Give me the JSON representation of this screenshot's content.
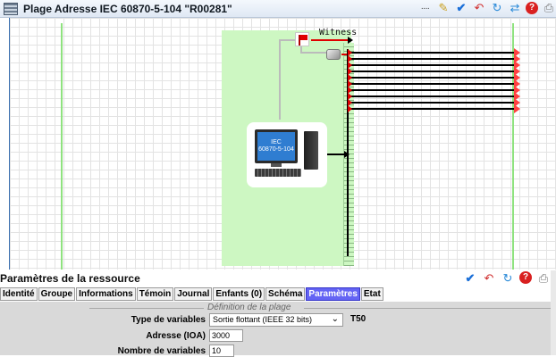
{
  "window": {
    "title": "Plage Adresse IEC 60870-5-104 \"R00281\"",
    "more_glyph": "····",
    "toolbar_icons": [
      "edit-icon",
      "check-icon",
      "undo-icon",
      "refresh-icon",
      "sync-icon",
      "help-icon",
      "print-icon"
    ]
  },
  "diagram": {
    "witness_label": "Witness",
    "device_screen_text": "IEC\n60870-5-104",
    "output_lines": 10
  },
  "panel": {
    "title": "Paramètres de la ressource",
    "icons": [
      "check-icon",
      "undo-icon",
      "refresh-icon",
      "help-icon",
      "print-icon"
    ],
    "tabs": [
      "Identité",
      "Groupe",
      "Informations",
      "Témoin",
      "Journal",
      "Enfants (0)",
      "Schéma",
      "Paramètres",
      "Etat"
    ],
    "active_tab": "Paramètres"
  },
  "params": {
    "section_title": "Définition de la plage",
    "type_label": "Type de variables",
    "type_value": "Sortie flottant (IEEE 32 bits)",
    "type_code": "T50",
    "address_label": "Adresse (IOA)",
    "address_value": "3000",
    "count_label": "Nombre de variables",
    "count_value": "10"
  },
  "colors": {
    "green_zone": "#cdf7c2",
    "active_tab": "#6464f4",
    "alert_red": "#e00000",
    "check_blue": "#1a6fd8"
  }
}
